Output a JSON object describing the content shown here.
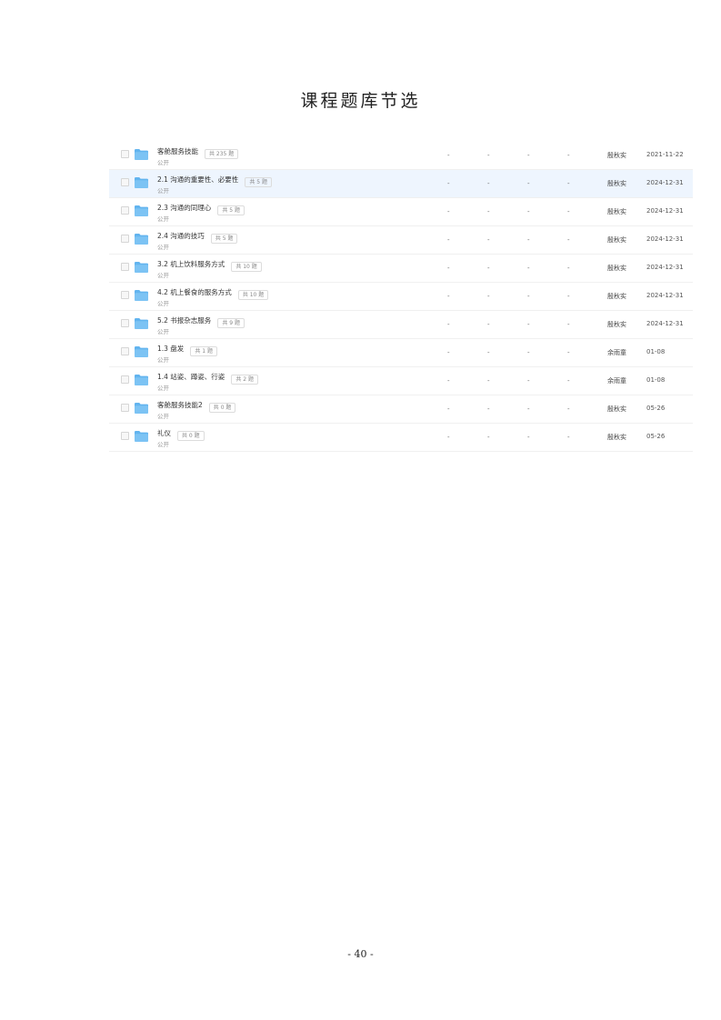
{
  "title": "课程题库节选",
  "page_number": "- 40 -",
  "icons": {
    "folder": "folder-icon",
    "checkbox": "checkbox"
  },
  "colors": {
    "folder": "#62b4ef",
    "highlight": "#eef5fe"
  },
  "rows": [
    {
      "name": "客舱服务技能",
      "count": "共 235 题",
      "visibility": "公开",
      "c1": "-",
      "c2": "-",
      "c3": "-",
      "c4": "-",
      "author": "殷秋实",
      "date": "2021-11-22"
    },
    {
      "name": "2.1 沟通的重要性、必要性",
      "count": "共 5 题",
      "visibility": "公开",
      "c1": "-",
      "c2": "-",
      "c3": "-",
      "c4": "-",
      "author": "殷秋实",
      "date": "2024-12-31",
      "highlight": true
    },
    {
      "name": "2.3 沟通的同理心",
      "count": "共 5 题",
      "visibility": "公开",
      "c1": "-",
      "c2": "-",
      "c3": "-",
      "c4": "-",
      "author": "殷秋实",
      "date": "2024-12-31"
    },
    {
      "name": "2.4 沟通的技巧",
      "count": "共 5 题",
      "visibility": "公开",
      "c1": "-",
      "c2": "-",
      "c3": "-",
      "c4": "-",
      "author": "殷秋实",
      "date": "2024-12-31"
    },
    {
      "name": "3.2 机上饮料服务方式",
      "count": "共 10 题",
      "visibility": "公开",
      "c1": "-",
      "c2": "-",
      "c3": "-",
      "c4": "-",
      "author": "殷秋实",
      "date": "2024-12-31"
    },
    {
      "name": "4.2 机上餐食的服务方式",
      "count": "共 10 题",
      "visibility": "公开",
      "c1": "-",
      "c2": "-",
      "c3": "-",
      "c4": "-",
      "author": "殷秋实",
      "date": "2024-12-31"
    },
    {
      "name": "5.2 书报杂志服务",
      "count": "共 9 题",
      "visibility": "公开",
      "c1": "-",
      "c2": "-",
      "c3": "-",
      "c4": "-",
      "author": "殷秋实",
      "date": "2024-12-31"
    },
    {
      "name": "1.3 盘发",
      "count": "共 1 题",
      "visibility": "公开",
      "c1": "-",
      "c2": "-",
      "c3": "-",
      "c4": "-",
      "author": "余雨童",
      "date": "01-08"
    },
    {
      "name": "1.4 站姿、蹲姿、行姿",
      "count": "共 2 题",
      "visibility": "公开",
      "c1": "-",
      "c2": "-",
      "c3": "-",
      "c4": "-",
      "author": "余雨童",
      "date": "01-08"
    },
    {
      "name": "客舱服务技能2",
      "count": "共 0 题",
      "visibility": "公开",
      "c1": "-",
      "c2": "-",
      "c3": "-",
      "c4": "-",
      "author": "殷秋实",
      "date": "05-26"
    },
    {
      "name": "礼仪",
      "count": "共 0 题",
      "visibility": "公开",
      "c1": "-",
      "c2": "-",
      "c3": "-",
      "c4": "-",
      "author": "殷秋实",
      "date": "05-26"
    }
  ]
}
